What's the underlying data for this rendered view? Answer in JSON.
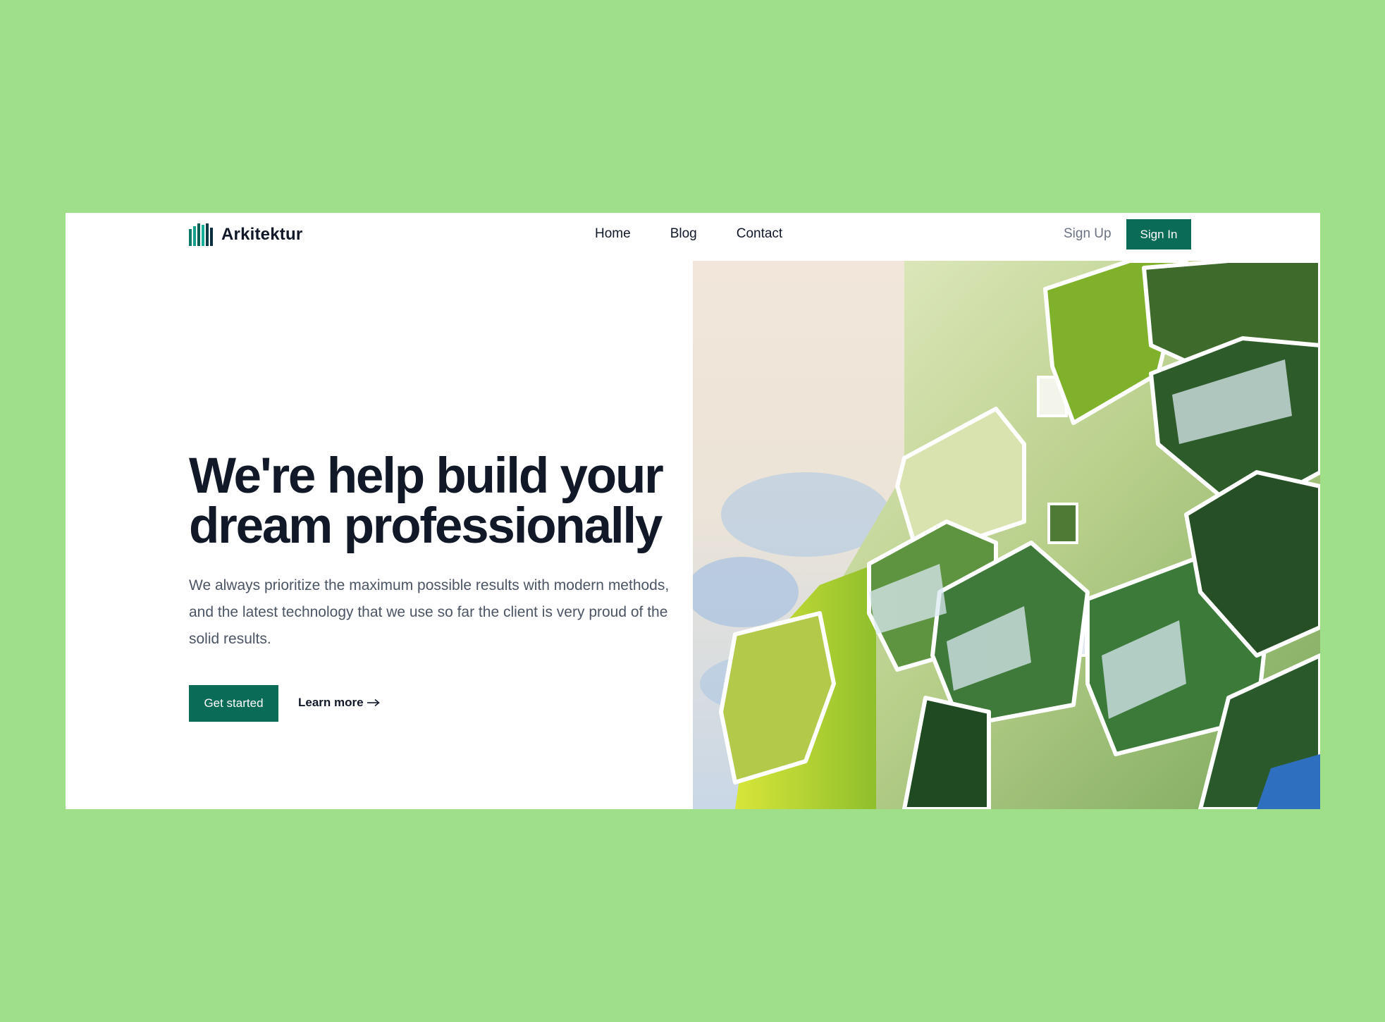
{
  "brand": {
    "name": "Arkitektur",
    "logo_icon": "building-columns-logo-icon"
  },
  "nav": {
    "links": [
      "Home",
      "Blog",
      "Contact"
    ]
  },
  "auth": {
    "signup_label": "Sign Up",
    "signin_label": "Sign In"
  },
  "hero": {
    "title_line1": "We're help build your",
    "title_line2": "dream professionally",
    "description": "We always prioritize the maximum possible results with modern methods, and the latest technology that we use so far the client is very proud of the solid results.",
    "cta_primary": "Get started",
    "cta_secondary": "Learn more",
    "cta_secondary_icon": "arrow-right-icon"
  },
  "colors": {
    "background": "#9fdf8a",
    "accent": "#0a6b56",
    "heading": "#111827",
    "body_text": "#4b5563"
  }
}
